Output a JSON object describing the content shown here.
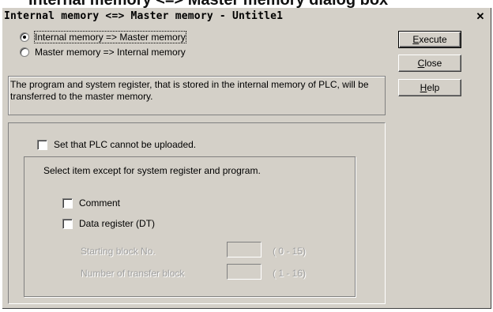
{
  "window": {
    "title": "Internal memory <=> Master memory - Untitle1",
    "background_title_fragment": "Internal memory <=> Master memory dialog box"
  },
  "direction": {
    "options": [
      {
        "label": "Internal memory => Master memory",
        "selected": true
      },
      {
        "label": "Master memory => Internal memory",
        "selected": false
      }
    ]
  },
  "description": "The program and system register, that is stored in the internal memory of PLC, will be transferred to the master memory.",
  "buttons": {
    "execute": {
      "label": "Execute",
      "mnemonic": "E",
      "rest": "xecute"
    },
    "close": {
      "label": "Close",
      "mnemonic": "C",
      "rest": "lose"
    },
    "help": {
      "label": "Help",
      "mnemonic": "H",
      "rest": "elp"
    }
  },
  "options": {
    "no_upload_label": "Set that PLC cannot be uploaded.",
    "no_upload_checked": false,
    "select_prompt": "Select item except for system register and program.",
    "comment_label": "Comment",
    "comment_checked": false,
    "data_register_label": "Data register (DT)",
    "data_register_checked": false,
    "starting_block_label": "Starting block No.",
    "starting_block_value": "",
    "starting_block_range": "( 0 - 15)",
    "transfer_blocks_label": "Number of transfer block",
    "transfer_blocks_value": "",
    "transfer_blocks_range": "( 1 - 16)"
  },
  "colors": {
    "dialog_bg": "#d4d0c8",
    "disabled_text": "#a0a0a0"
  }
}
